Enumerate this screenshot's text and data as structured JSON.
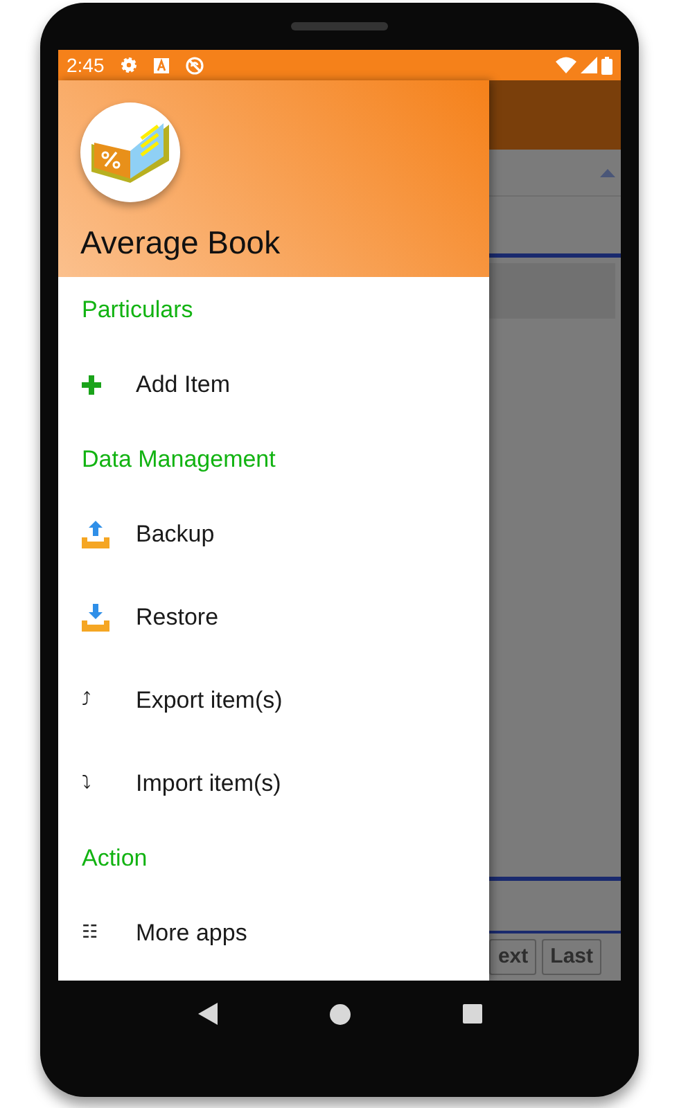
{
  "status_bar": {
    "time": "2:45"
  },
  "drawer": {
    "title": "Average Book",
    "entries": [
      {
        "kind": "header",
        "label": "Particulars"
      },
      {
        "kind": "plus",
        "label": "Add Item"
      },
      {
        "kind": "header",
        "label": "Data Management"
      },
      {
        "kind": "upload",
        "label": "Backup"
      },
      {
        "kind": "download",
        "label": "Restore"
      },
      {
        "kind": "glyph",
        "glyph": "⤴",
        "label": "Export item(s)"
      },
      {
        "kind": "glyph",
        "glyph": "⤵",
        "label": "Import item(s)"
      },
      {
        "kind": "header",
        "label": "Action"
      },
      {
        "kind": "glyph",
        "glyph": "☷",
        "label": "More apps"
      }
    ]
  },
  "background": {
    "buttons": [
      "ext",
      "Last"
    ]
  }
}
